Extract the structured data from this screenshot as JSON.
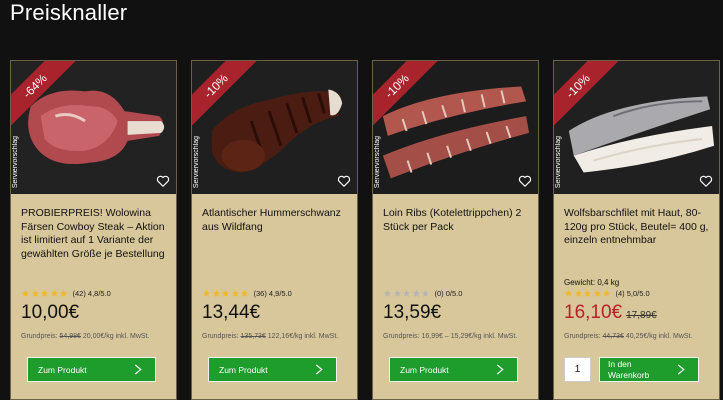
{
  "section": {
    "title": "Preisknaller"
  },
  "products": [
    {
      "discount": "-64%",
      "serving_label": "Serviervorschlag",
      "title": "PROBIERPREIS! Wolowina Färsen Cowboy Steak – Aktion ist limitiert auf 1 Variante der gewählten Größe je Bestellung",
      "rating": {
        "stars": 4.8,
        "count_text": "(42) 4,8/5.0"
      },
      "price": "10,00€",
      "base_price_prefix": "Grundpreis: ",
      "base_price_old": "54,98€",
      "base_price_new": " 20,00€/kg inkl. MwSt.",
      "button": "Zum Produkt"
    },
    {
      "discount": "-10%",
      "serving_label": "Serviervorschlag",
      "title": "Atlantischer Hummerschwanz aus Wildfang",
      "rating": {
        "stars": 4.9,
        "count_text": "(36) 4,9/5.0"
      },
      "price": "13,44€",
      "base_price_prefix": "Grundpreis: ",
      "base_price_old": "135,73€",
      "base_price_new": " 122,16€/kg inkl. MwSt.",
      "button": "Zum Produkt"
    },
    {
      "discount": "-10%",
      "serving_label": "Serviervorschlag",
      "title": "Loin Ribs (Kotelettrippchen) 2 Stück per Pack",
      "rating": {
        "stars": 0,
        "count_text": "(0) 0/5.0"
      },
      "price": "13,59€",
      "base_price_text": "Grundpreis: 16,99€ – 15,29€/kg inkl. MwSt.",
      "button": "Zum Produkt"
    },
    {
      "discount": "-10%",
      "serving_label": "Serviervorschlag",
      "title": "Wolfsbarschfilet mit Haut, 80-120g pro Stück, Beutel= 400 g, einzeln entnehmbar",
      "weight": "Gewicht: 0,4 kg",
      "rating": {
        "stars": 5.0,
        "count_text": "(4) 5,0/5.0"
      },
      "price": "16,10€",
      "old_price": "17,89€",
      "base_price_prefix": "Grundpreis: ",
      "base_price_old": "44,73€",
      "base_price_new": " 40,25€/kg inkl. MwSt.",
      "quantity": "1",
      "button": "In den Warenkorb"
    }
  ],
  "colors": {
    "card_bg": "#d8c79a",
    "ribbon": "#a8232c",
    "button": "#1e9c2c",
    "sale_price": "#b8202a",
    "star_filled": "#f0b92a",
    "star_empty": "#b5b5b5"
  },
  "icons": [
    "heart-icon",
    "star-icon",
    "chevron-right-icon"
  ]
}
